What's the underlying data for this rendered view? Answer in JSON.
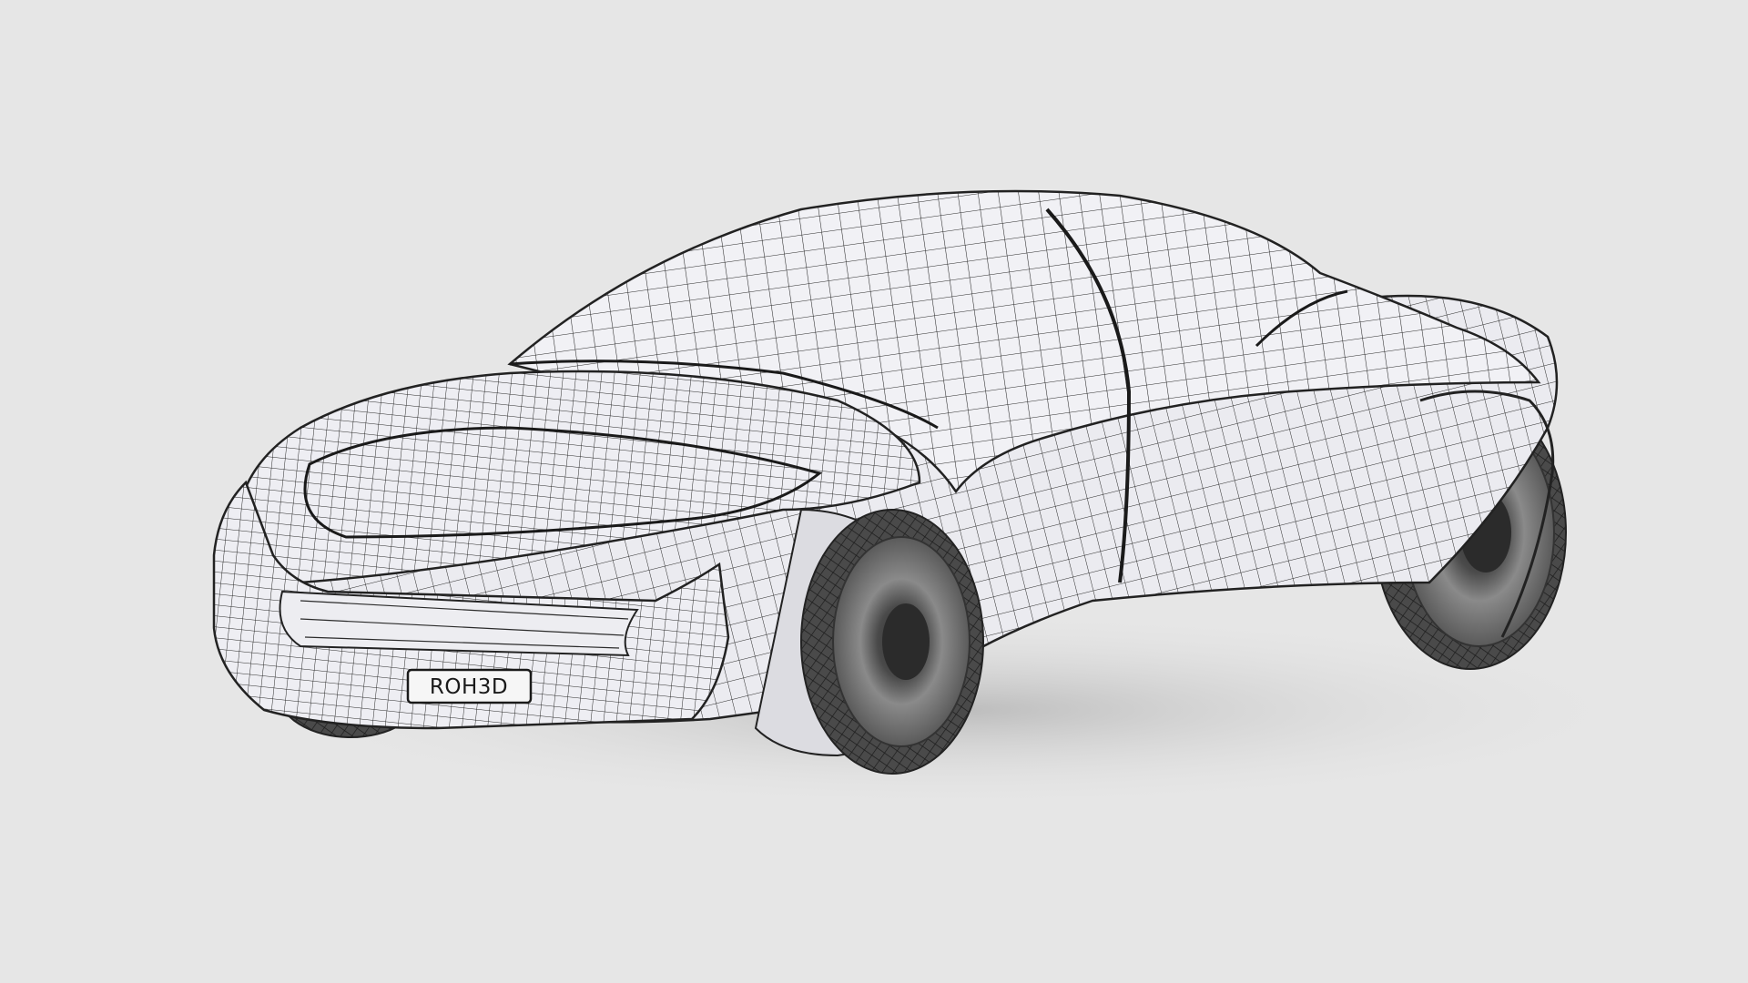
{
  "scene": {
    "subject_icon": "car-wireframe",
    "background_color": "#e6e6e6",
    "body_color": "#f2f2f6",
    "wire_color": "#2a2a2a",
    "tire_color": "#3c3c3c",
    "rim_color": "#7a7a7a"
  },
  "license_plate": {
    "text": "ROH3D"
  }
}
